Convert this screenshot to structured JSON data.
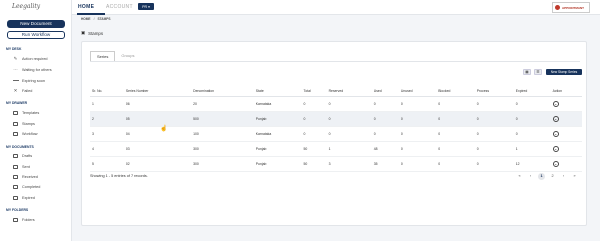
{
  "app": {
    "logo_text": "Leegality"
  },
  "sidebar": {
    "new_document_label": "New Document",
    "run_workflow_label": "Run Workflow",
    "sections": {
      "my_desk": "MY DESK",
      "my_drawer": "MY DRAWER",
      "my_documents": "MY DOCUMENTS",
      "my_folders": "MY FOLDERS"
    },
    "desk_items": [
      "Action required",
      "Waiting for others",
      "Expiring soon",
      "Failed"
    ],
    "drawer_items": [
      "Templates",
      "Stamps",
      "Workflow"
    ],
    "document_items": [
      "Drafts",
      "Sent",
      "Received",
      "Completed",
      "Expired"
    ],
    "folder_items": [
      "Folders"
    ]
  },
  "topbar": {
    "home_tab": "HOME",
    "account_tab": "ACCOUNT",
    "org_select_value": "PR",
    "brand_text": "APPOINTMANT"
  },
  "breadcrumb": {
    "home": "HOME",
    "separator": "/",
    "current": "STAMPS"
  },
  "page": {
    "title": "Stamps"
  },
  "tabs": {
    "series": "Series",
    "groups": "Groups"
  },
  "toolbar": {
    "new_stamp_series_label": "New Stamp Series"
  },
  "table": {
    "headers": [
      "Sr. No.",
      "Series Number",
      "Denomination",
      "State",
      "Total",
      "Reserved",
      "Used",
      "Unused",
      "Blocked",
      "Process",
      "Expired",
      "Action"
    ],
    "rows": [
      [
        "1",
        "06",
        "20",
        "Karnataka",
        "0",
        "0",
        "0",
        "0",
        "0",
        "0",
        "0"
      ],
      [
        "2",
        "05",
        "500",
        "Punjab",
        "0",
        "0",
        "0",
        "0",
        "0",
        "0",
        "0"
      ],
      [
        "3",
        "04",
        "100",
        "Karnataka",
        "0",
        "0",
        "0",
        "0",
        "0",
        "0",
        "0"
      ],
      [
        "4",
        "03",
        "300",
        "Punjab",
        "50",
        "1",
        "48",
        "0",
        "0",
        "0",
        "1"
      ],
      [
        "5",
        "02",
        "300",
        "Punjab",
        "50",
        "3",
        "35",
        "0",
        "0",
        "0",
        "12"
      ]
    ],
    "highlighted_row_index": 1
  },
  "footer": {
    "showing_text": "Showing 1 - 5 entries of 7 records.",
    "pager": [
      "«",
      "‹",
      "1",
      "2",
      "›",
      "»"
    ],
    "current_page": "1"
  },
  "colors": {
    "primary": "#17335c",
    "brand_red": "#c0392b"
  }
}
